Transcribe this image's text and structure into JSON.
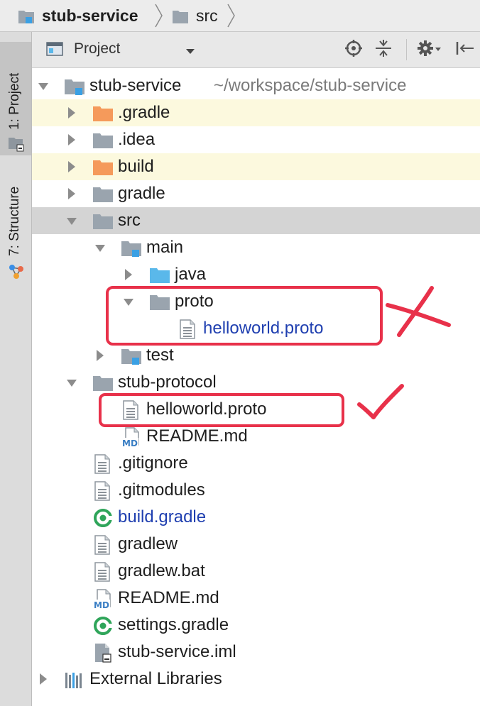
{
  "breadcrumb": [
    {
      "label": "stub-service",
      "bold": true
    },
    {
      "label": "src",
      "bold": false
    }
  ],
  "side_tabs": {
    "project": "1: Project",
    "structure": "7: Structure"
  },
  "toolbar": {
    "view_label": "Project"
  },
  "tree": [
    {
      "label": "stub-service",
      "hint": "~/workspace/stub-service"
    },
    {
      "label": ".gradle"
    },
    {
      "label": ".idea"
    },
    {
      "label": "build"
    },
    {
      "label": "gradle"
    },
    {
      "label": "src"
    },
    {
      "label": "main"
    },
    {
      "label": "java"
    },
    {
      "label": "proto"
    },
    {
      "label": "helloworld.proto"
    },
    {
      "label": "test"
    },
    {
      "label": "stub-protocol"
    },
    {
      "label": "helloworld.proto"
    },
    {
      "label": "README.md"
    },
    {
      "label": ".gitignore"
    },
    {
      "label": ".gitmodules"
    },
    {
      "label": "build.gradle"
    },
    {
      "label": "gradlew"
    },
    {
      "label": "gradlew.bat"
    },
    {
      "label": "README.md"
    },
    {
      "label": "settings.gradle"
    },
    {
      "label": "stub-service.iml"
    },
    {
      "label": "External Libraries"
    }
  ],
  "md_badge": "MD",
  "colors": {
    "folder": "#9aa4ae",
    "folder_excluded": "#f59a5b",
    "folder_source": "#5ab8ea",
    "module_marker": "#3aa0e4",
    "selection_gray": "#d4d4d4",
    "excluded_bg": "#fcf9de",
    "link_blue": "#1f3fb0",
    "gradle_green": "#2fa55a",
    "annotation_red": "#e8314a"
  },
  "icons": [
    "folder-icon",
    "file-text-icon",
    "gradle-icon",
    "markdown-icon",
    "iml-icon",
    "libraries-icon",
    "locate-icon",
    "collapse-icon",
    "gear-icon",
    "hide-icon"
  ]
}
